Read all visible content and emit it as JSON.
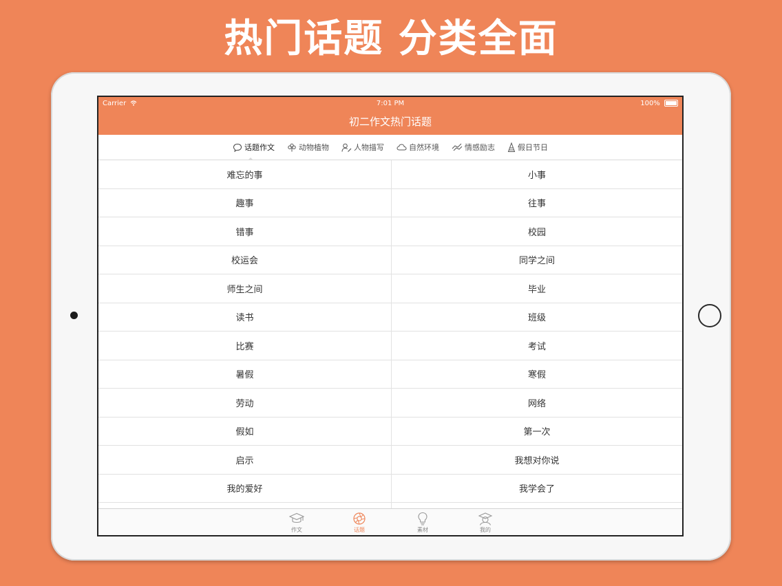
{
  "headline": "热门话题 分类全面",
  "status_bar": {
    "carrier": "Carrier",
    "time": "7:01 PM",
    "battery": "100%"
  },
  "nav": {
    "title": "初二作文热门话题"
  },
  "segments": [
    {
      "label": "话题作文",
      "icon": "speech-bubble-icon",
      "active": true
    },
    {
      "label": "动物植物",
      "icon": "flower-icon",
      "active": false
    },
    {
      "label": "人物描写",
      "icon": "person-pen-icon",
      "active": false
    },
    {
      "label": "自然环境",
      "icon": "cloud-icon",
      "active": false
    },
    {
      "label": "情感励志",
      "icon": "hands-icon",
      "active": false
    },
    {
      "label": "假日节日",
      "icon": "party-hat-icon",
      "active": false
    }
  ],
  "topics": {
    "left": [
      "难忘的事",
      "趣事",
      "错事",
      "校运会",
      "师生之间",
      "读书",
      "比赛",
      "暑假",
      "劳动",
      "假如",
      "启示",
      "我的爱好"
    ],
    "right": [
      "小事",
      "往事",
      "校园",
      "同学之间",
      "毕业",
      "班级",
      "考试",
      "寒假",
      "网络",
      "第一次",
      "我想对你说",
      "我学会了"
    ]
  },
  "tabs": [
    {
      "label": "作文",
      "icon": "graduation-cap-icon",
      "active": false
    },
    {
      "label": "话题",
      "icon": "aperture-icon",
      "active": true
    },
    {
      "label": "素材",
      "icon": "lightbulb-icon",
      "active": false
    },
    {
      "label": "我的",
      "icon": "user-cap-icon",
      "active": false
    }
  ],
  "colors": {
    "accent": "#ef8558",
    "background": "#ef8558"
  }
}
